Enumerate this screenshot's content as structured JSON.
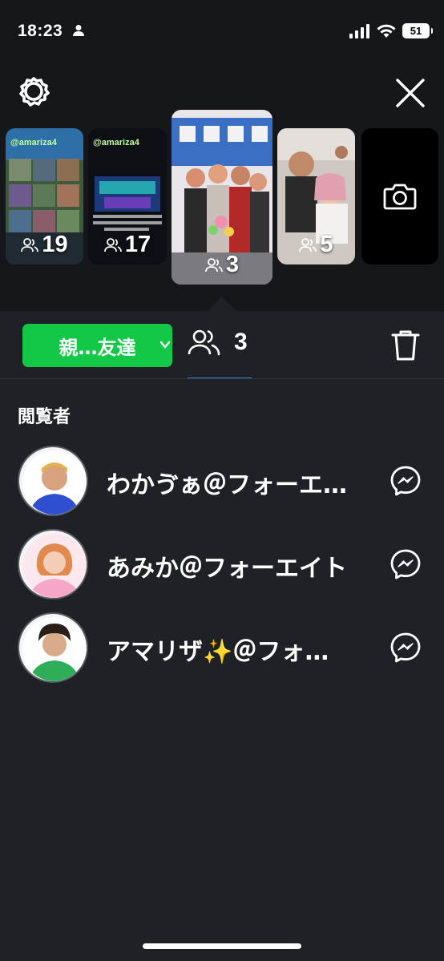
{
  "status_bar": {
    "time": "18:23",
    "battery": "51",
    "icons": [
      "person-icon",
      "signal-icon",
      "wifi-icon",
      "battery-icon"
    ]
  },
  "header": {
    "settings_icon": "gear-icon",
    "close_icon": "close-icon"
  },
  "stories": [
    {
      "handle": "@amariza4",
      "viewers": "19"
    },
    {
      "handle": "@amariza4",
      "viewers": "17"
    },
    {
      "handle": "",
      "viewers": "3"
    },
    {
      "handle": "",
      "viewers": "5"
    },
    {
      "handle": "",
      "viewers": "",
      "icon": "camera-icon"
    }
  ],
  "controls": {
    "audience_label": "親…友達",
    "viewer_count": "3",
    "accent": "#14c847"
  },
  "viewers_section": {
    "title": "閲覧者",
    "viewers": [
      {
        "name": "わかゔぁ＠フォーエ…"
      },
      {
        "name": "あみか＠フォーエイト"
      },
      {
        "name": "アマリザ✨＠フォ…"
      }
    ]
  }
}
